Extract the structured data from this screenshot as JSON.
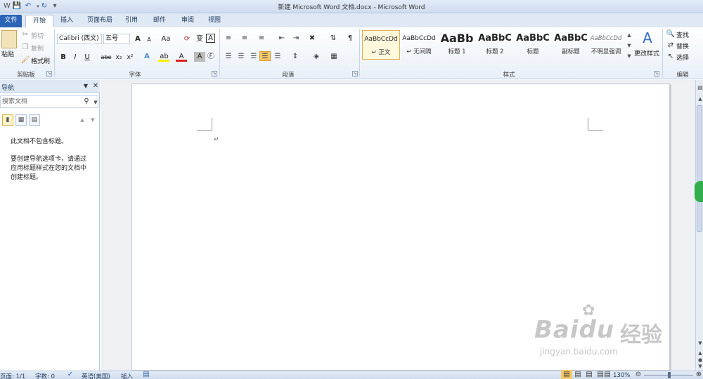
{
  "window": {
    "title": "新建 Microsoft Word 文档.docx - Microsoft Word"
  },
  "qat": {
    "save_icon": "save-icon",
    "undo_icon": "undo-icon",
    "redo_icon": "redo-icon",
    "customize_icon": "customize-qat-icon"
  },
  "tabs": [
    {
      "label": "文件"
    },
    {
      "label": "开始"
    },
    {
      "label": "插入"
    },
    {
      "label": "页面布局"
    },
    {
      "label": "引用"
    },
    {
      "label": "邮件"
    },
    {
      "label": "审阅"
    },
    {
      "label": "视图"
    }
  ],
  "clipboard": {
    "paste": "粘贴",
    "cut": "剪切",
    "copy": "复制",
    "format_painter": "格式刷",
    "group_label": "剪贴板"
  },
  "font": {
    "name": "Calibri (西文)",
    "size": "五号",
    "grow": "A",
    "shrink": "A",
    "change_case": "Aa",
    "bold": "B",
    "italic": "I",
    "underline": "U",
    "strike": "abe",
    "subscript": "x₂",
    "superscript": "x²",
    "group_label": "字体"
  },
  "paragraph": {
    "group_label": "段落"
  },
  "styles": {
    "items": [
      {
        "sample": "AaBbCcDd",
        "name": "↵ 正文"
      },
      {
        "sample": "AaBbCcDd",
        "name": "↵ 无间隔"
      },
      {
        "sample": "AaBb",
        "name": "标题 1"
      },
      {
        "sample": "AaBbC",
        "name": "标题 2"
      },
      {
        "sample": "AaBbC",
        "name": "标题"
      },
      {
        "sample": "AaBbC",
        "name": "副标题"
      },
      {
        "sample": "AaBbCcDd",
        "name": "不明显强调"
      }
    ],
    "change_styles": "更改样式",
    "group_label": "样式"
  },
  "editing": {
    "find": "查找",
    "replace": "替换",
    "select": "选择",
    "group_label": "编辑"
  },
  "nav_pane": {
    "title": "导航",
    "search_placeholder": "搜索文档",
    "msg1": "此文档不包含标题。",
    "msg2_line1": "要创建导航选项卡，请通过",
    "msg2_line2": "应用标题样式在您的文档中",
    "msg2_line3": "创建标题。"
  },
  "document": {
    "paragraph_mark": "↵"
  },
  "status_bar": {
    "page": "页面: 1/1",
    "words": "字数: 0",
    "language": "英语(美国)",
    "mode": "插入",
    "zoom": "130%"
  },
  "watermark": {
    "brand": "Baidu",
    "brand_cn": "经验",
    "url": "jingyan.baidu.com"
  },
  "colors": {
    "accent": "#2b64b6",
    "ribbon_bg": "#dfe9f5",
    "doc_bg": "#eef0f4",
    "highlight": "#fff8dd"
  }
}
